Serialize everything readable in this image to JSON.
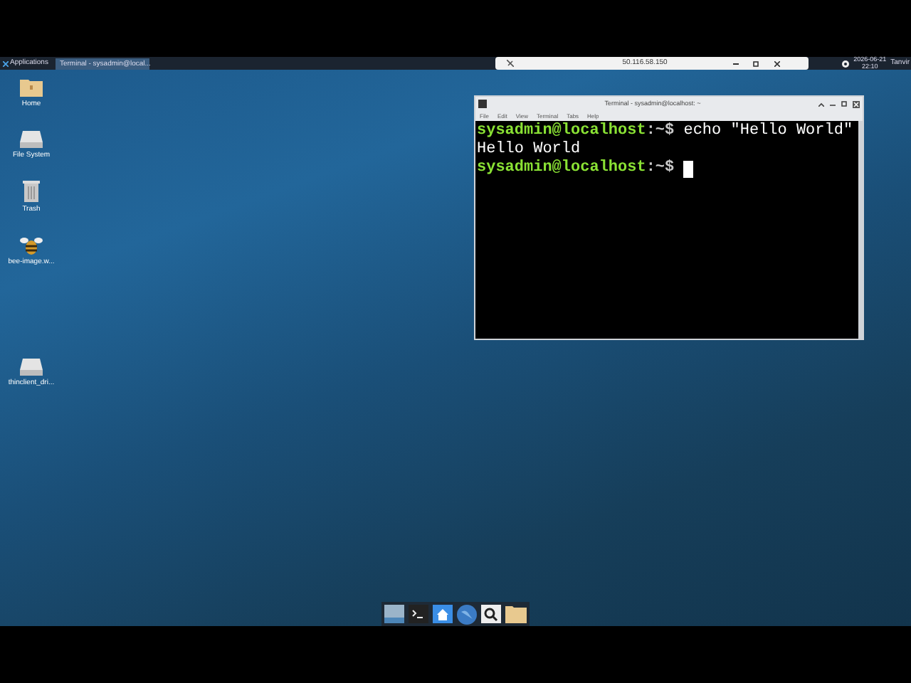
{
  "top_panel": {
    "applications_label": "Applications",
    "taskbar": [
      {
        "label": "Terminal - sysadmin@local...",
        "selected": true
      }
    ],
    "remote_bar": {
      "address": "50.116.58.150"
    },
    "clock": {
      "date": "2026-06-21",
      "time": "22:10"
    },
    "user": "Tanvir"
  },
  "desktop_icons": [
    {
      "label": "Home",
      "kind": "folder"
    },
    {
      "label": "File System",
      "kind": "drive"
    },
    {
      "label": "Trash",
      "kind": "trash"
    },
    {
      "label": "bee-image.w...",
      "kind": "image"
    },
    {
      "label": "thinclient_dri...",
      "kind": "drive"
    }
  ],
  "terminal": {
    "title": "Terminal - sysadmin@localhost: ~",
    "menu": [
      "File",
      "Edit",
      "View",
      "Terminal",
      "Tabs",
      "Help"
    ],
    "lines": [
      {
        "kind": "prompt",
        "user_host": "sysadmin@localhost",
        "prompt": ":~$",
        "command": "echo \"Hello World\""
      },
      {
        "kind": "output",
        "text": "Hello World"
      },
      {
        "kind": "prompt",
        "user_host": "sysadmin@localhost",
        "prompt": ":~$",
        "cursor": true
      }
    ]
  },
  "dock": [
    {
      "kind": "desktop"
    },
    {
      "kind": "terminal"
    },
    {
      "kind": "home"
    },
    {
      "kind": "browser"
    },
    {
      "kind": "search"
    },
    {
      "kind": "folder"
    }
  ]
}
